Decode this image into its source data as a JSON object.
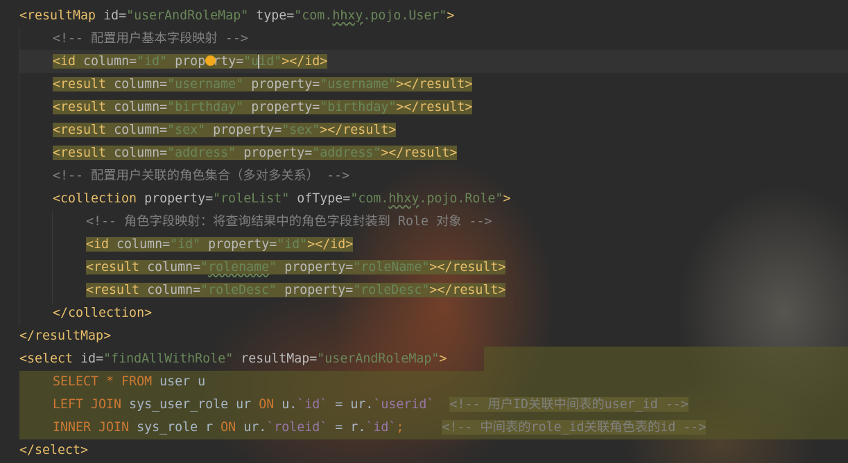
{
  "editor": {
    "colors": {
      "background": "#2b2b2b",
      "tag": "#e8bf6a",
      "attribute": "#bababa",
      "string": "#6a8759",
      "comment": "#808080",
      "keyword": "#cc7832",
      "sql_field": "#9876aa",
      "highlight": "#615c2f",
      "intention_bulb": "#f2a91c"
    },
    "icons": {
      "bulb": "intention-bulb-icon"
    },
    "lines": [
      {
        "tokens": [
          "<resultMap",
          "id",
          "=",
          "\"userAndRoleMap\"",
          "type",
          "=",
          "\"com.",
          "hhxy",
          ".pojo.User\"",
          ">"
        ]
      },
      {
        "tokens": [
          "<!-- 配置用户基本字段映射 -->"
        ]
      },
      {
        "tokens": [
          "<id",
          "column",
          "=",
          "\"id\"",
          "pro",
          "perty",
          "=",
          "\"u",
          "id\"",
          "></id>"
        ]
      },
      {
        "tokens": [
          "<result",
          "column",
          "=",
          "\"username\"",
          "property",
          "=",
          "\"username\"",
          "></result>"
        ]
      },
      {
        "tokens": [
          "<result",
          "column",
          "=",
          "\"birthday\"",
          "property",
          "=",
          "\"birthday\"",
          "></result>"
        ]
      },
      {
        "tokens": [
          "<result",
          "column",
          "=",
          "\"sex\"",
          "property",
          "=",
          "\"sex\"",
          "></result>"
        ]
      },
      {
        "tokens": [
          "<result",
          "column",
          "=",
          "\"address\"",
          "property",
          "=",
          "\"address\"",
          "></result>"
        ]
      },
      {
        "tokens": [
          "<!-- 配置用户关联的角色集合（多对多关系） -->"
        ]
      },
      {
        "tokens": [
          "<collection",
          "property",
          "=",
          "\"roleList\"",
          "ofType",
          "=",
          "\"com.",
          "hhxy",
          ".pojo.Role\"",
          ">"
        ]
      },
      {
        "tokens": [
          "<!-- 角色字段映射：将查询结果中的角色字段封装到 Role 对象 -->"
        ]
      },
      {
        "tokens": [
          "<id",
          "column",
          "=",
          "\"id\"",
          "property",
          "=",
          "\"id\"",
          "></id>"
        ]
      },
      {
        "tokens": [
          "<result",
          "column",
          "=",
          "\"",
          "rolename",
          "\"",
          "property",
          "=",
          "\"roleName\"",
          "></result>"
        ]
      },
      {
        "tokens": [
          "<result",
          "column",
          "=",
          "\"roleDesc\"",
          "property",
          "=",
          "\"roleDesc\"",
          "></result>"
        ]
      },
      {
        "tokens": [
          "</collection>"
        ]
      },
      {
        "tokens": [
          "</resultMap>"
        ]
      },
      {
        "tokens": [
          "<select",
          "id",
          "=",
          "\"findAllWithRole\"",
          "resultMap",
          "=",
          "\"userAndRoleMap\"",
          ">"
        ]
      },
      {
        "tokens": [
          "SELECT",
          "*",
          "FROM",
          "user u"
        ]
      },
      {
        "tokens": [
          "LEFT JOIN",
          "sys_user_role ur",
          "ON",
          "u.",
          "`id`",
          "=",
          "ur.",
          "`userid`",
          "<!-- 用户ID关联中间表的user_id -->"
        ]
      },
      {
        "tokens": [
          "INNER JOIN",
          "sys_role r",
          "ON",
          "ur.",
          "`roleid`",
          "=",
          "r.",
          "`id`",
          ";",
          "<!-- 中间表的role_id关联角色表的id -->"
        ]
      },
      {
        "tokens": [
          "</select>"
        ]
      }
    ]
  }
}
